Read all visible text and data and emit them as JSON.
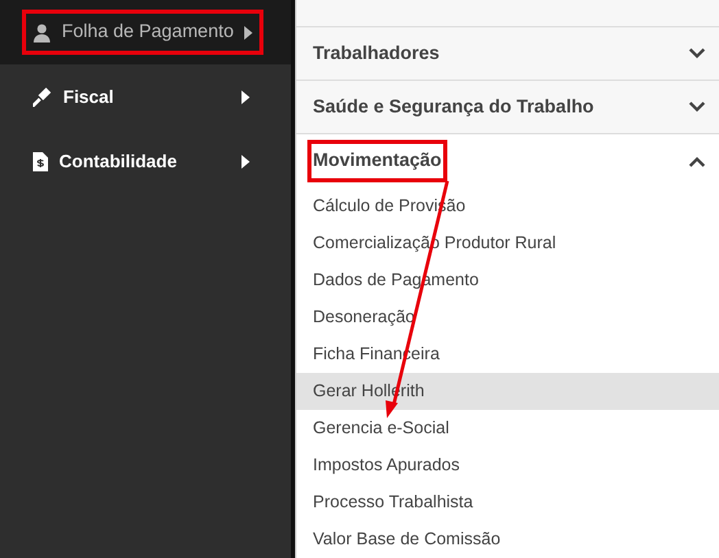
{
  "sidebar": {
    "items": [
      {
        "label": "Folha de Pagamento",
        "selected": true,
        "highlighted": true
      },
      {
        "label": "Fiscal",
        "selected": false,
        "highlighted": false
      },
      {
        "label": "Contabilidade",
        "selected": false,
        "highlighted": false
      }
    ]
  },
  "sections": [
    {
      "title": "Trabalhadores",
      "expanded": false,
      "highlighted": false
    },
    {
      "title": "Saúde e Segurança do Trabalho",
      "expanded": false,
      "highlighted": false
    },
    {
      "title": "Movimentação",
      "expanded": true,
      "highlighted": true,
      "items": [
        {
          "label": "Cálculo de Provisão",
          "selected": false
        },
        {
          "label": "Comercialização Produtor Rural",
          "selected": false
        },
        {
          "label": "Dados de Pagamento",
          "selected": false
        },
        {
          "label": "Desoneração",
          "selected": false
        },
        {
          "label": "Ficha Financeira",
          "selected": false
        },
        {
          "label": "Gerar Hollerith",
          "selected": true
        },
        {
          "label": "Gerencia e-Social",
          "selected": false
        },
        {
          "label": "Impostos Apurados",
          "selected": false
        },
        {
          "label": "Processo Trabalhista",
          "selected": false
        },
        {
          "label": "Valor Base de Comissão",
          "selected": false
        }
      ]
    }
  ]
}
